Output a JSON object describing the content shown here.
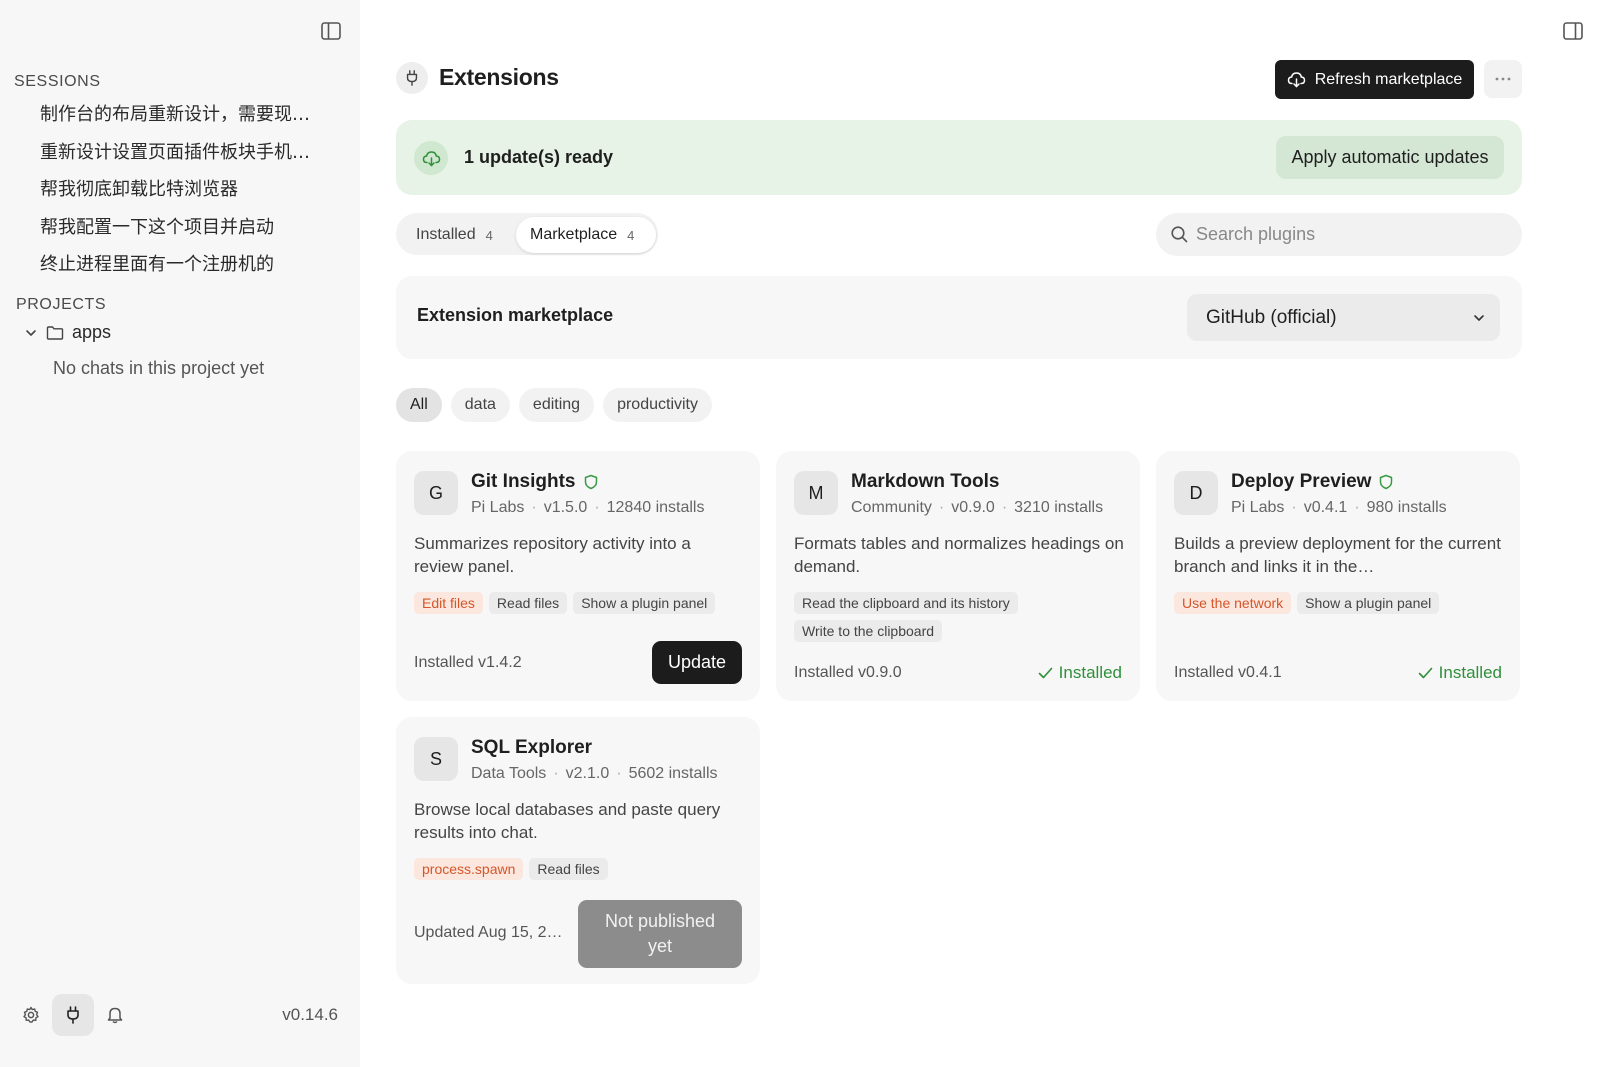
{
  "sidebar": {
    "sessions_label": "SESSIONS",
    "sessions": [
      "制作台的布局重新设计，需要现…",
      "重新设计设置页面插件板块手机…",
      "帮我彻底卸载比特浏览器",
      "帮我配置一下这个项目并启动",
      "终止进程里面有一个注册机的"
    ],
    "projects_label": "PROJECTS",
    "project": {
      "name": "apps",
      "empty_text": "No chats in this project yet",
      "icon": "folder-icon"
    },
    "footer": {
      "version": "v0.14.6",
      "icons": [
        "gear-icon",
        "plug-icon",
        "bell-icon"
      ]
    }
  },
  "header": {
    "title": "Extensions",
    "icon": "plug-icon",
    "refresh_label": "Refresh marketplace",
    "more_icon": "ellipsis-icon"
  },
  "update_banner": {
    "text": "1 update(s) ready",
    "apply_label": "Apply automatic updates"
  },
  "tabs": [
    {
      "label": "Installed",
      "count": "4"
    },
    {
      "label": "Marketplace",
      "count": "4",
      "active": true
    }
  ],
  "search": {
    "placeholder": "Search plugins",
    "value": ""
  },
  "marketplace": {
    "label": "Extension marketplace",
    "selected_source": "GitHub (official)"
  },
  "filters": [
    "All",
    "data",
    "editing",
    "productivity"
  ],
  "active_filter": "All",
  "plugins": [
    {
      "initial": "G",
      "name": "Git Insights",
      "verified": true,
      "publisher": "Pi Labs",
      "version": "v1.5.0",
      "installs": "12840 installs",
      "description": "Summarizes repository activity into a review panel.",
      "permissions": [
        {
          "label": "Edit files",
          "warn": true
        },
        {
          "label": "Read files",
          "warn": false
        },
        {
          "label": "Show a plugin panel",
          "warn": false
        }
      ],
      "footer_text": "Installed v1.4.2",
      "action": "Update"
    },
    {
      "initial": "M",
      "name": "Markdown Tools",
      "verified": false,
      "publisher": "Community",
      "version": "v0.9.0",
      "installs": "3210 installs",
      "description": "Formats tables and normalizes headings on demand.",
      "permissions": [
        {
          "label": "Read the clipboard and its history",
          "warn": false
        },
        {
          "label": "Write to the clipboard",
          "warn": false
        }
      ],
      "footer_text": "Installed v0.9.0",
      "action": "Installed"
    },
    {
      "initial": "D",
      "name": "Deploy Preview",
      "verified": true,
      "publisher": "Pi Labs",
      "version": "v0.4.1",
      "installs": "980 installs",
      "description": "Builds a preview deployment for the current branch and links it in the…",
      "permissions": [
        {
          "label": "Use the network",
          "warn": true
        },
        {
          "label": "Show a plugin panel",
          "warn": false
        }
      ],
      "footer_text": "Installed v0.4.1",
      "action": "Installed"
    },
    {
      "initial": "S",
      "name": "SQL Explorer",
      "verified": false,
      "publisher": "Data Tools",
      "version": "v2.1.0",
      "installs": "5602 installs",
      "description": "Browse local databases and paste query results into chat.",
      "permissions": [
        {
          "label": "process.spawn",
          "warn": true
        },
        {
          "label": "Read files",
          "warn": false
        }
      ],
      "footer_text": "Updated Aug 15, 2…",
      "action": "Not published yet"
    }
  ],
  "colors": {
    "accent_dark": "#1c1c1c",
    "success": "#2f8f3a",
    "warning": "#d4562a",
    "banner_bg": "#e6f3e6"
  }
}
